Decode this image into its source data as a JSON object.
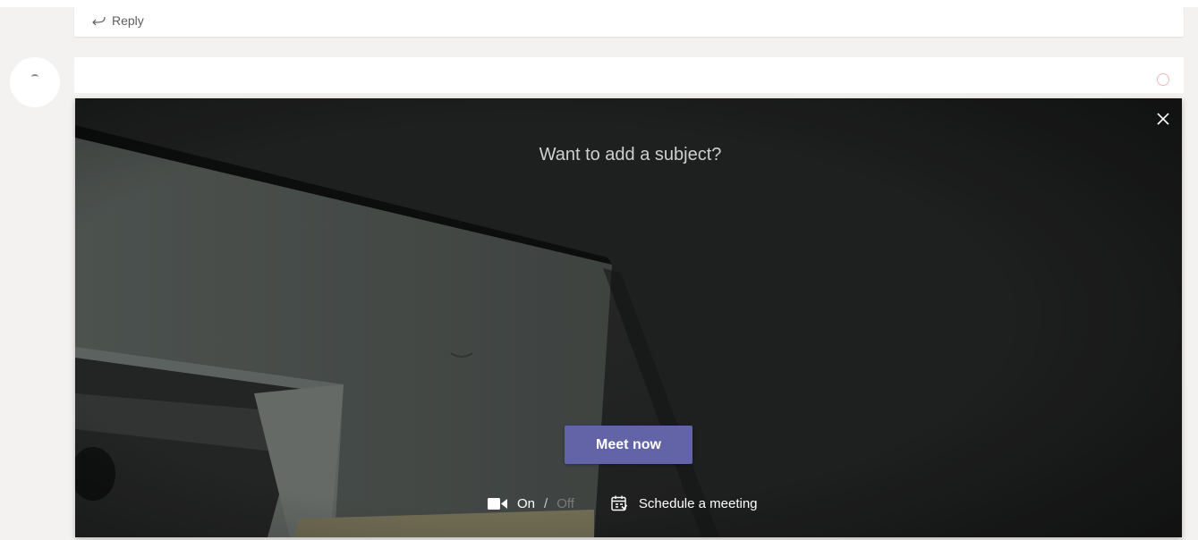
{
  "thread": {
    "reply_label": "Reply"
  },
  "meet_panel": {
    "subject_placeholder": "Want to add a subject?",
    "subject_value": "",
    "meet_now_label": "Meet now",
    "video": {
      "on_label": "On",
      "separator": "/",
      "off_label": "Off",
      "state": "on"
    },
    "schedule_label": "Schedule a meeting"
  },
  "icons": {
    "reply": "reply-arrow-icon",
    "close": "close-icon",
    "video": "video-camera-icon",
    "schedule": "calendar-icon"
  },
  "colors": {
    "accent": "#6264a7",
    "page_background": "#f3f2f1",
    "panel_background": "#262626"
  }
}
